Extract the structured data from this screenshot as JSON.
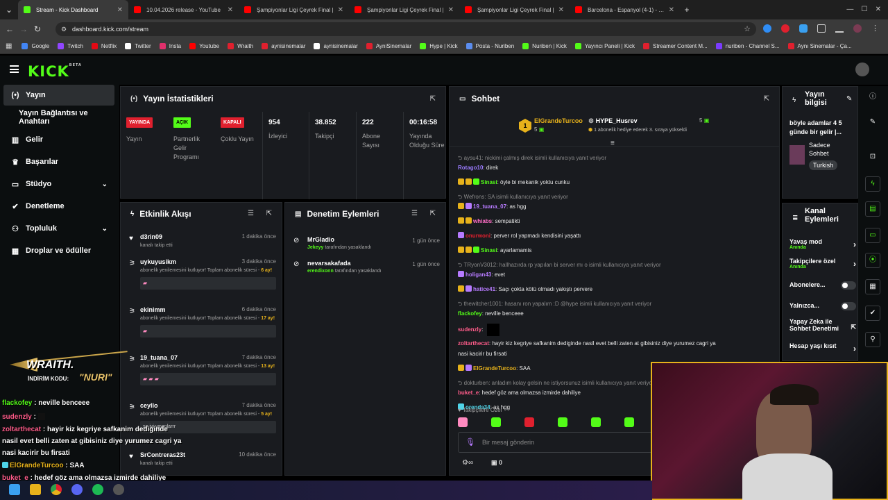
{
  "browser": {
    "tabs": [
      {
        "title": "Stream - Kick Dashboard",
        "color": "#53fc18"
      },
      {
        "title": "10.04.2026 release - YouTube",
        "color": "#ff0000"
      },
      {
        "title": "Şampiyonlar Ligi Çeyrek Final |",
        "color": "#ff0000"
      },
      {
        "title": "Şampiyonlar Ligi Çeyrek Final |",
        "color": "#ff0000"
      },
      {
        "title": "Şampiyonlar Ligi Çeyrek Final |",
        "color": "#ff0000"
      },
      {
        "title": "Barcelona - Espanyol (4-1) - Ma",
        "color": "#ff0000"
      }
    ],
    "url": "dashboard.kick.com/stream",
    "bookmarks": [
      "Google",
      "Twitch",
      "Netflix",
      "Twitter",
      "Insta",
      "Youtube",
      "Wraith",
      "aynisinemalar",
      "aynisinemalar",
      "AyniSinemalar",
      "Hype | Kick",
      "Posta - Nuriben",
      "Nuriben | Kick",
      "Yayıncı Paneli | Kick",
      "Streamer Content M...",
      "nuriben - Channel S...",
      "Aynı Sinemalar - Ça..."
    ]
  },
  "kick": {
    "logo": "KICK",
    "logo_sup": "BETA"
  },
  "sidebar": [
    {
      "label": "Yayın",
      "icon": "broadcast-icon"
    },
    {
      "label": "Yayın Bağlantısı ve Anahtarı",
      "icon": ""
    },
    {
      "label": "Gelir",
      "icon": "revenue-icon"
    },
    {
      "label": "Başarılar",
      "icon": "trophy-icon"
    },
    {
      "label": "Stüdyo",
      "icon": "studio-icon"
    },
    {
      "label": "Denetleme",
      "icon": "wrench-icon"
    },
    {
      "label": "Topluluk",
      "icon": "community-icon"
    },
    {
      "label": "Droplar ve ödüller",
      "icon": "drops-icon"
    }
  ],
  "stats": {
    "title": "Yayın İstatistikleri",
    "items": [
      {
        "pill": "YAYINDA",
        "label": "Yayın",
        "color": "#e0202e"
      },
      {
        "pill": "AÇIK",
        "label": "Partnerlik Gelir Programı",
        "color": "#53fc18"
      },
      {
        "pill": "KAPALI",
        "label": "Çoklu Yayın",
        "color": "#e0202e"
      },
      {
        "value": "954",
        "label": "İzleyici"
      },
      {
        "value": "38.852",
        "label": "Takipçi"
      },
      {
        "value": "222",
        "label": "Abone Sayısı"
      },
      {
        "value": "00:16:58",
        "label": "Yayında Olduğu Süre"
      }
    ]
  },
  "activity": {
    "title": "Etkinlik Akışı",
    "items": [
      {
        "user": "d3rin09",
        "time": "1 dakika önce",
        "desc": "kanalı takip etti",
        "box": false
      },
      {
        "user": "uykuyusikm",
        "time": "3 dakika önce",
        "desc": "abonelik yenilemesini kutluyor! Toplam abonelik süresi - ",
        "months": "6 ay!",
        "box": true
      },
      {
        "user": "ekinimm",
        "time": "6 dakika önce",
        "desc": "abonelik yenilemesini kutluyor! Toplam abonelik süresi - ",
        "months": "17 ay!",
        "box": true
      },
      {
        "user": "19_tuana_07",
        "time": "7 dakika önce",
        "desc": "abonelik yenilemesini kutluyor! Toplam abonelik süresi - ",
        "months": "13 ay!",
        "box": true
      },
      {
        "user": "ceyllo",
        "time": "7 dakika önce",
        "desc": "abonelik yenilemesini kutluyor! Toplam abonelik süresi - ",
        "months": "5 ay!",
        "box": true,
        "boxtext": "sa iyi yayınlarrr"
      },
      {
        "user": "SrContreras23t",
        "time": "10 dakika önce",
        "desc": "kanalı takip etti",
        "box": false
      }
    ]
  },
  "moderation": {
    "title": "Denetim Eylemleri",
    "items": [
      {
        "user": "MrGladio",
        "time": "1 gün önce",
        "by": "Jekeyy",
        "action": "tarafından yasaklandı"
      },
      {
        "user": "nevarsakafada",
        "time": "1 gün önce",
        "by": "erendixonn",
        "action": "tarafından yasaklandı"
      }
    ]
  },
  "chat": {
    "title": "Sohbet",
    "pinned_left": {
      "name": "ElGrandeTurcoo",
      "count": "5"
    },
    "pinned_right": {
      "name": "HYPE_Husrev",
      "count": "5",
      "note": "1 abonelik hediye ederek 3. sıraya yükseldi"
    },
    "messages": [
      {
        "sys": "aysu41: nickimi çalmış direk isimli kullanıcıya yanıt veriyor"
      },
      {
        "name": "Rotago10",
        "color": "#9b7bff",
        "text": ": direk"
      },
      {
        "name": "Sinasi",
        "color": "#53fc18",
        "text": ": öyle bi mekanik yoktu cunku"
      },
      {
        "sys": "Wefrons: SA isimli kullanıcıya yanıt veriyor"
      },
      {
        "name": "19_tuana_07",
        "color": "#b77bff",
        "text": ": as hgg"
      },
      {
        "name": "whiabs",
        "color": "#ff6ec7",
        "text": ": sempatikti"
      },
      {
        "name": "onurwoni",
        "color": "#e0202e",
        "text": ": perver rol yapmadı kendisini yaşattı"
      },
      {
        "name": "Sinasi",
        "color": "#53fc18",
        "text": ": ayarlamamis"
      },
      {
        "sys": "TRyonV3012: hallhazırda rp yapılan bi server mı o isimli kullanıcıya yanıt veriyor"
      },
      {
        "name": "holigan43",
        "color": "#b77bff",
        "text": ": evet"
      },
      {
        "name": "hatice41",
        "color": "#b77bff",
        "text": ": Saçı çokta kötü olmadı yakıştı pervere"
      },
      {
        "sys": "thewitcher1001: hasanı ron yapalım :D @hype isimli kullanıcıya yanıt veriyor"
      },
      {
        "name": "flackofey",
        "color": "#53fc18",
        "text": ": neville benceee"
      },
      {
        "name": "sudenzly",
        "color": "#ff5c8a",
        "text": ":"
      },
      {
        "name": "zoltarthecat",
        "color": "#ff5c8a",
        "text": ": hayir kiz kegriye safkanim dediginde nasil evet belli zaten at gibisiniz diye yurumez cagri ya"
      },
      {
        "cont": "nasi kacirir bu firsati"
      },
      {
        "name": "ElGrandeTurcoo",
        "color": "#e7b21b",
        "text": ": SAA"
      },
      {
        "sys": "dokturben: anladım kolay gelsin ne istiyorsunuz isimli kullanıcıya yanıt veriyor"
      },
      {
        "name": "buket_e",
        "color": "#ff5c8a",
        "text": ": hedef göz ama olmazsa izmirde dahiliye"
      },
      {
        "name": "orenda34",
        "color": "#4fd4e8",
        "text": ": as hgg"
      }
    ],
    "followers_only": "Takipçilere Özel",
    "input_placeholder": "Bir mesaj gönderin",
    "footer_count": "0"
  },
  "stream_info": {
    "title": "Yayın bilgisi",
    "desc": "böyle adamlar 4 5 günde bir gelir |...",
    "category": "Sadece Sohbet",
    "tag": "Turkish"
  },
  "channel_actions": {
    "title": "Kanal Eylemleri",
    "items": [
      {
        "label": "Yavaş mod",
        "sub": "Anında",
        "kind": "chevron"
      },
      {
        "label": "Takipçilere özel",
        "sub": "Anında",
        "kind": "chevron"
      },
      {
        "label": "Abonelere...",
        "kind": "toggle"
      },
      {
        "label": "Yalnızca...",
        "kind": "toggle"
      },
      {
        "label": "Yapay Zeka ile Sohbet Denetimi",
        "kind": "external"
      },
      {
        "label": "Hesap yaşı kısıt",
        "kind": "chevron"
      }
    ]
  },
  "overlay": {
    "sponsor": "WRAITH.",
    "code_label": "İNDİRİM KODU:",
    "code": "NURI",
    "lines": [
      {
        "name": "flackofey",
        "color": "#53fc18",
        "text": " : neville benceee"
      },
      {
        "name": "sudenzly",
        "color": "#ff5c8a",
        "text": " :"
      },
      {
        "name": "zoltarthecat",
        "color": "#ff5c8a",
        "text": " : hayir kiz kegriye safkanim dediginde"
      },
      {
        "cont": "nasil evet belli zaten at gibisiniz diye yurumez cagri ya"
      },
      {
        "cont": "nasi kacirir bu firsati"
      },
      {
        "name": "ElGrandeTurcoo",
        "color": "#e7b21b",
        "text": " : SAA"
      },
      {
        "name": "buket_e",
        "color": "#ff5c8a",
        "text": " : hedef göz ama olmazsa izmirde dahiliye"
      }
    ]
  }
}
